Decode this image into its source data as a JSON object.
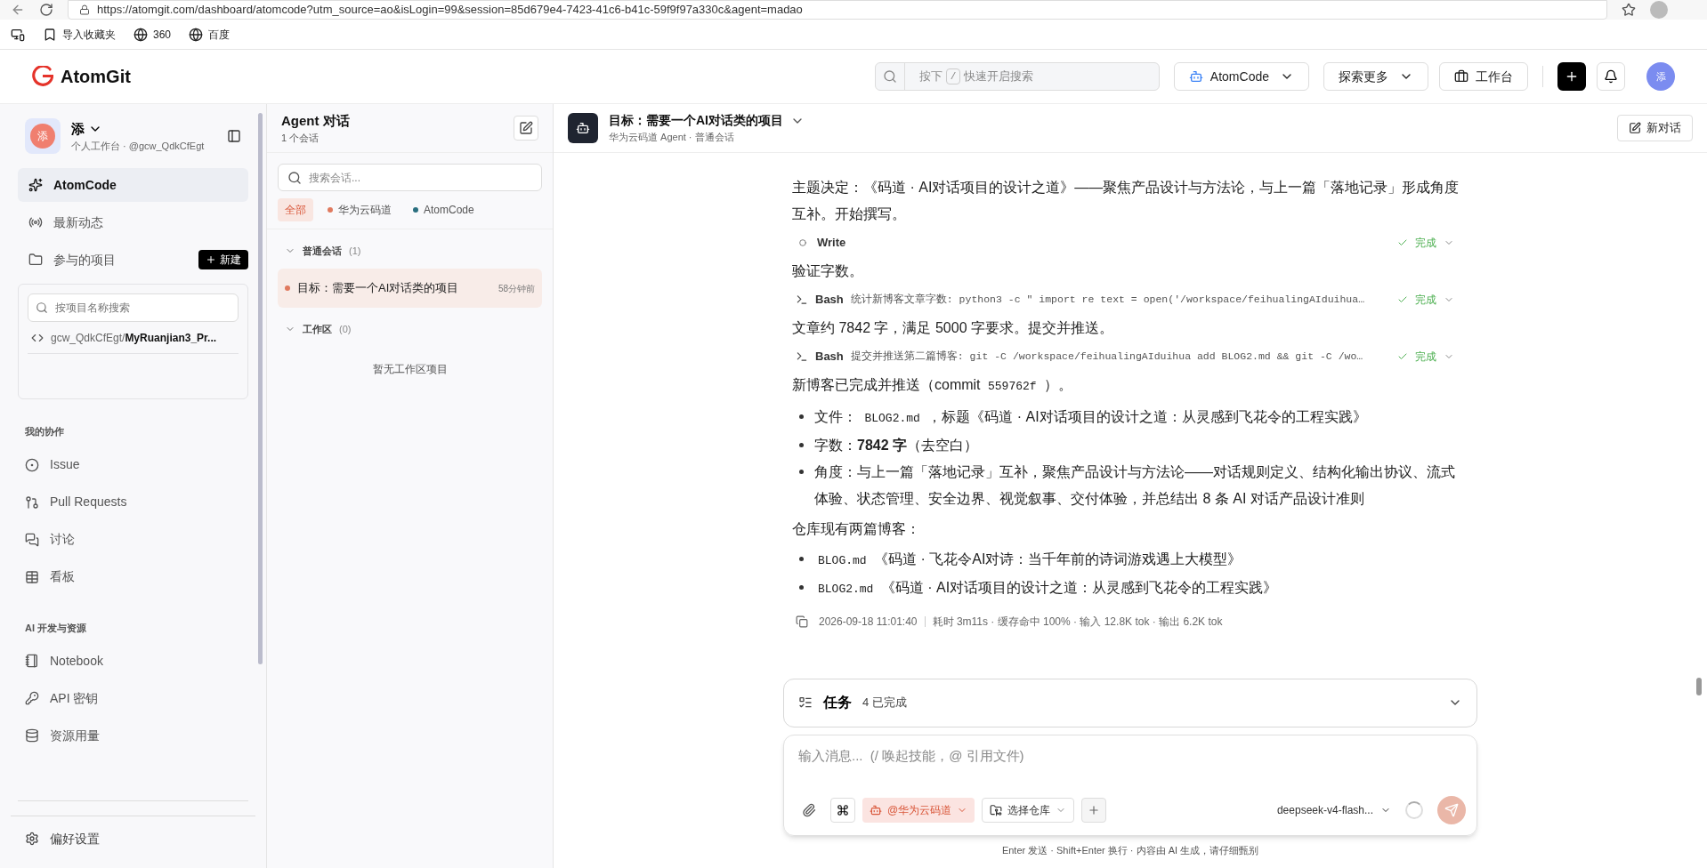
{
  "browser": {
    "url": "https://atomgit.com/dashboard/atomcode?utm_source=ao&isLogin=99&session=85d679e4-7423-41c6-b41c-59f9f97a330c&agent=madao",
    "bookmarks": [
      "导入收藏夹",
      "360",
      "百度"
    ]
  },
  "header": {
    "logo": "AtomGit",
    "search": {
      "prefix": "按下",
      "key": "/",
      "placeholder": "快速开启搜索"
    },
    "menus": [
      "AtomCode",
      "探索更多"
    ],
    "workbench": "工作台",
    "avatar": "添"
  },
  "sidebar": {
    "user": {
      "avatar": "添",
      "name": "添",
      "subtitle": "个人工作台 · @gcw_QdkCfEgt"
    },
    "nav": [
      {
        "label": "AtomCode",
        "selected": true
      },
      {
        "label": "最新动态",
        "selected": false
      },
      {
        "label": "参与的项目",
        "selected": false
      }
    ],
    "new_button": "新建",
    "projects": {
      "placeholder": "按项目名称搜索",
      "items": [
        {
          "owner": "gcw_QdkCfEgt/",
          "name": "MyRuanjian3_Pr..."
        }
      ]
    },
    "sections": [
      {
        "title": "我的协作",
        "items": [
          "Issue",
          "Pull Requests",
          "讨论",
          "看板"
        ]
      },
      {
        "title": "AI 开发与资源",
        "items": [
          "Notebook",
          "API 密钥",
          "资源用量"
        ]
      }
    ],
    "settings": "偏好设置"
  },
  "conversations": {
    "title": "Agent 对话",
    "count": "1 个会话",
    "placeholder": "搜索会话...",
    "filters": [
      {
        "label": "全部",
        "selected": true
      },
      {
        "label": "华为云码道",
        "color": "#e07a5f",
        "selected": false
      },
      {
        "label": "AtomCode",
        "color": "#2a6f7f",
        "selected": false
      }
    ],
    "groups": [
      {
        "title": "普通会话",
        "count": "(1)",
        "expanded": true,
        "items": [
          {
            "title": "目标：需要一个AI对话类的项目",
            "time": "58分钟前",
            "color": "#e07a5f",
            "selected": true
          }
        ]
      },
      {
        "title": "工作区",
        "count": "(0)",
        "expanded": true,
        "empty": "暂无工作区项目"
      }
    ]
  },
  "chat": {
    "title": "目标：需要一个AI对话类的项目",
    "subtitle": "华为云码道 Agent · 普通会话",
    "new_chat": "新对话",
    "blocks": [
      {
        "kind": "paragraph",
        "parts": [
          {
            "kind": "text",
            "text": "主题决定：《码道 · AI对话项目的设计之道》——聚焦产品设计与方法论，与上一篇「落地记录」形成角度互补。开始撰写。"
          }
        ]
      },
      {
        "kind": "tool",
        "terminal": false,
        "name": "Write",
        "status": "完成"
      },
      {
        "kind": "paragraph",
        "parts": [
          {
            "kind": "text",
            "text": "验证字数。"
          }
        ]
      },
      {
        "kind": "tool",
        "terminal": true,
        "name": "Bash",
        "detail": "统计新博客文章字数: python3 -c \" import re text = open('/workspace/feihualingAIduihua…",
        "status": "完成"
      },
      {
        "kind": "paragraph",
        "parts": [
          {
            "kind": "text",
            "text": "文章约 7842 字，满足 5000 字要求。提交并推送。"
          }
        ]
      },
      {
        "kind": "tool",
        "terminal": true,
        "name": "Bash",
        "detail": "提交并推送第二篇博客: git -C /workspace/feihualingAIduihua add BLOG2.md && git -C /wo…",
        "status": "完成"
      },
      {
        "kind": "paragraph",
        "parts": [
          {
            "kind": "text",
            "text": "新博客已完成并推送（commit "
          },
          {
            "kind": "code",
            "text": "559762f"
          },
          {
            "kind": "text",
            "text": " ）。"
          }
        ]
      },
      {
        "kind": "list",
        "items": [
          [
            {
              "kind": "text",
              "text": "文件： "
            },
            {
              "kind": "code",
              "text": "BLOG2.md"
            },
            {
              "kind": "text",
              "text": " ，标题《码道 · AI对话项目的设计之道：从灵感到飞花令的工程实践》"
            }
          ],
          [
            {
              "kind": "text",
              "text": "字数："
            },
            {
              "kind": "bold",
              "text": "7842 字"
            },
            {
              "kind": "text",
              "text": "（去空白）"
            }
          ],
          [
            {
              "kind": "text",
              "text": "角度：与上一篇「落地记录」互补，聚焦产品设计与方法论——对话规则定义、结构化输出协议、流式体验、状态管理、安全边界、视觉叙事、交付体验，并总结出 8 条 AI 对话产品设计准则"
            }
          ]
        ]
      },
      {
        "kind": "paragraph",
        "parts": [
          {
            "kind": "text",
            "text": "仓库现有两篇博客："
          }
        ]
      },
      {
        "kind": "list",
        "items": [
          [
            {
              "kind": "code",
              "text": "BLOG.md"
            },
            {
              "kind": "text",
              "text": " 《码道 · 飞花令AI对诗：当千年前的诗词游戏遇上大模型》"
            }
          ],
          [
            {
              "kind": "code",
              "text": "BLOG2.md"
            },
            {
              "kind": "text",
              "text": " 《码道 · AI对话项目的设计之道：从灵感到飞花令的工程实践》"
            }
          ]
        ]
      },
      {
        "kind": "meta",
        "time": "2026-09-18 11:01:40",
        "stats": "耗时 3m11s · 缓存命中 100% · 输入 12.8K tok · 输出 6.2K tok"
      }
    ]
  },
  "tasks": {
    "title": "任务",
    "summary": "4 已完成",
    "expanded": false
  },
  "composer": {
    "placeholder": "输入消息...  (/ 唤起技能，@ 引用文件)",
    "agent": "@华为云码道",
    "repo": "选择仓库",
    "model": "deepseek-v4-flash...",
    "note": "Enter 发送 · Shift+Enter 换行 · 内容由 AI 生成，请仔细甄别"
  }
}
